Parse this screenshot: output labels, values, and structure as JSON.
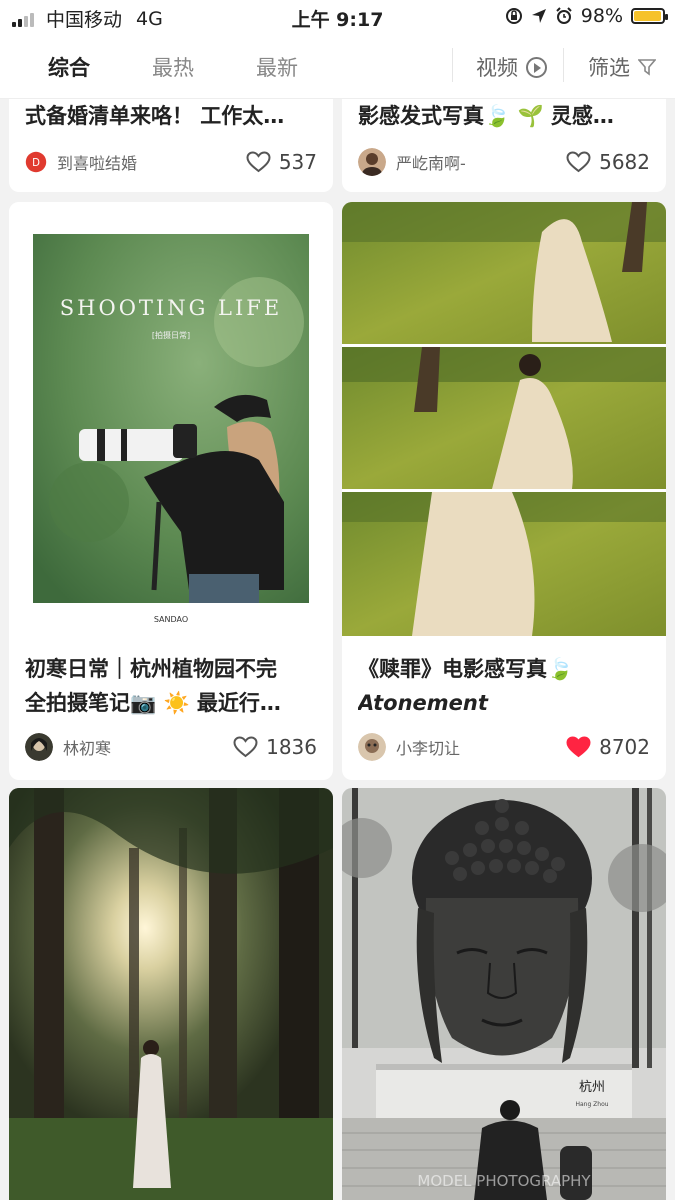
{
  "status_bar": {
    "carrier": "中国移动",
    "network": "4G",
    "time": "上午 9:17",
    "battery": "98%",
    "battery_level": 0.98
  },
  "nav": {
    "tabs": [
      {
        "label": "综合",
        "active": true
      },
      {
        "label": "最热",
        "active": false
      },
      {
        "label": "最新",
        "active": false
      }
    ],
    "video_label": "视频",
    "filter_label": "筛选"
  },
  "cards": [
    {
      "title": "式备婚清单来咯！ 工作太…",
      "author": "到喜啦结婚",
      "likes": "537",
      "liked": false
    },
    {
      "title": "影感发式写真🍃 🌱 灵感…",
      "author": "严屹南啊-",
      "likes": "5682",
      "liked": false
    },
    {
      "title_lines": [
        "初寒日常｜杭州植物园不完",
        "全拍摄笔记📷 ☀️ 最近行…"
      ],
      "cover_text": "SHOOTING LIFE",
      "cover_sub": "[拍摄日常]",
      "cover_brand": "SANDAO",
      "author": "林初寒",
      "likes": "1836",
      "liked": false
    },
    {
      "title_lines": [
        "《赎罪》电影感写真🍃",
        "Atonement"
      ],
      "author": "小李切让",
      "likes": "8702",
      "liked": true
    },
    {
      "statue_sign": "杭州",
      "statue_sign_sub": "Hang Zhou",
      "watermark": "MODEL PHOTOGRAPHY"
    }
  ],
  "colors": {
    "liked_heart": "#ff2442",
    "battery": "#f6c22a"
  }
}
